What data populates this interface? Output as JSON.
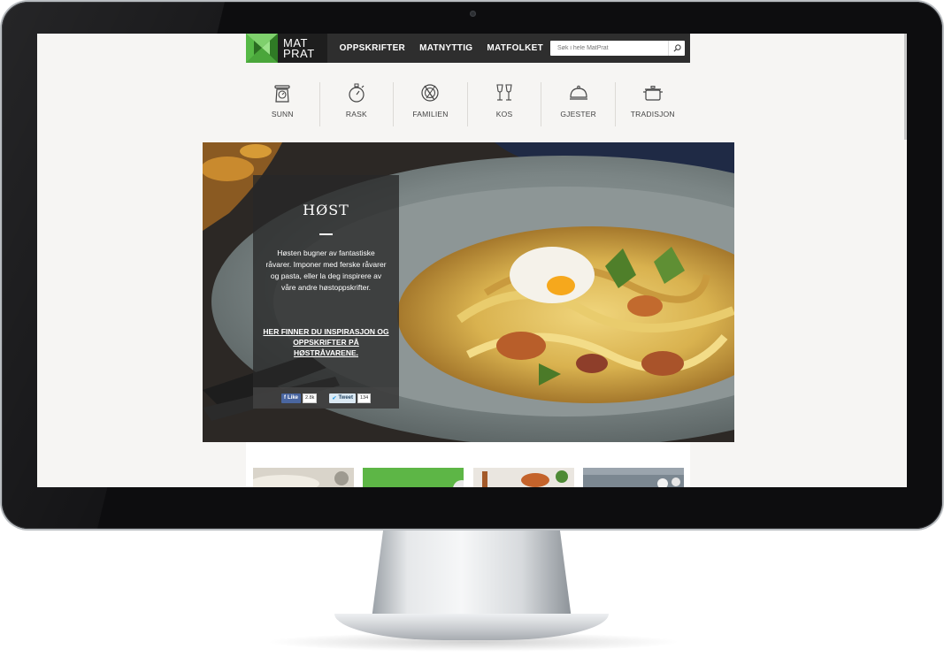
{
  "header": {
    "logo_line1": "MAT",
    "logo_line2": "PRAT",
    "nav": [
      {
        "label": "OPPSKRIFTER"
      },
      {
        "label": "MATNYTTIG"
      },
      {
        "label": "MATFOLKET"
      }
    ],
    "search": {
      "placeholder": "Søk i hele MatPrat",
      "icon": "search-icon"
    }
  },
  "categories": [
    {
      "label": "SUNN",
      "icon": "scale-icon"
    },
    {
      "label": "RASK",
      "icon": "stopwatch-icon"
    },
    {
      "label": "FAMILIEN",
      "icon": "plate-cutlery-icon"
    },
    {
      "label": "KOS",
      "icon": "wine-glasses-icon"
    },
    {
      "label": "GJESTER",
      "icon": "cloche-icon"
    },
    {
      "label": "TRADISJON",
      "icon": "pot-icon"
    }
  ],
  "hero": {
    "title": "HØST",
    "text": "Høsten bugner av fantastiske råvarer. Imponer med ferske råvarer og pasta, eller la deg inspirere av våre andre høstoppskrifter.",
    "link": "HER FINNER DU INSPIRASJON OG OPPSKRIFTER PÅ HØSTRÅVARENE.",
    "share": {
      "facebook_label": "Like",
      "facebook_count": "2.8k",
      "twitter_label": "Tweet",
      "twitter_count": "134"
    }
  },
  "colors": {
    "brand_green": "#4cae3c",
    "header_bg": "#2e2e2e",
    "page_bg": "#f6f5f3"
  }
}
